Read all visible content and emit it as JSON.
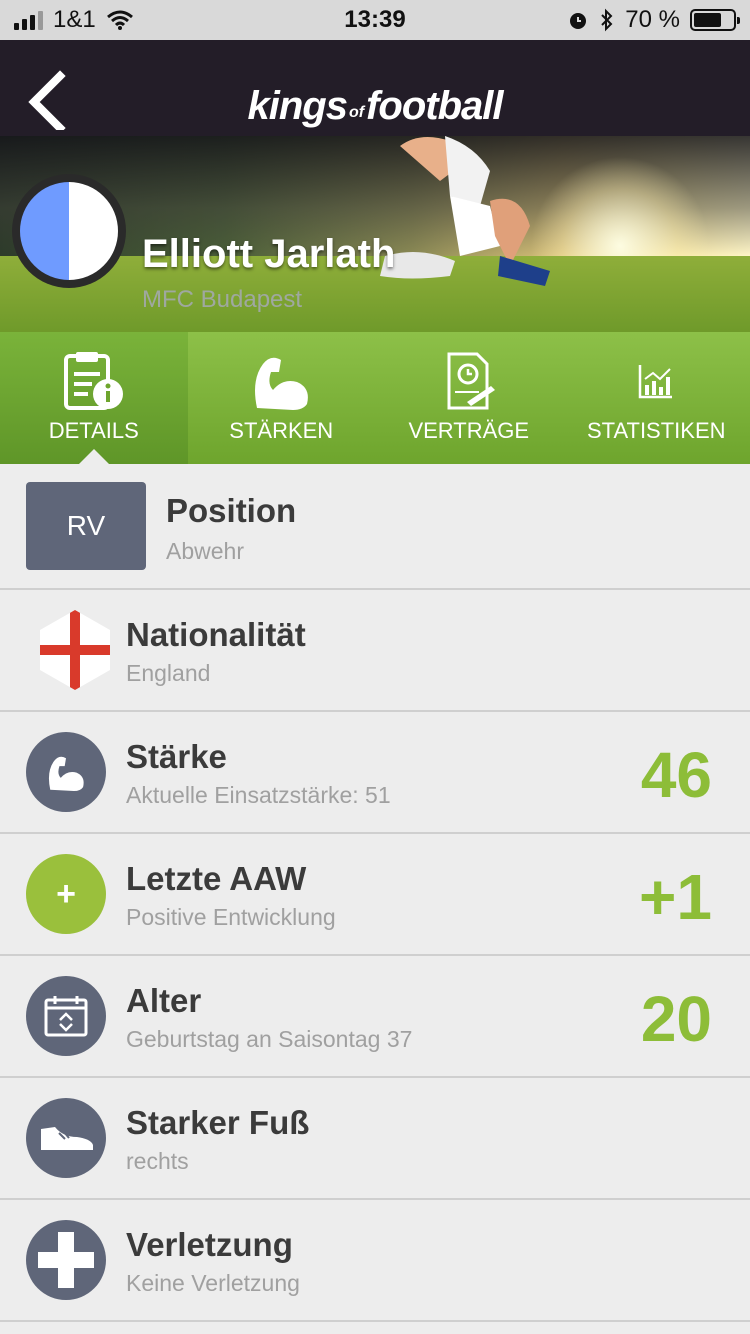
{
  "status_bar": {
    "carrier": "1&1",
    "time": "13:39",
    "battery": "70 %"
  },
  "header": {
    "brand_kings": "kings",
    "brand_of": "of",
    "brand_football": "football"
  },
  "player": {
    "name": "Elliott Jarlath",
    "club": "MFC Budapest"
  },
  "tabs": [
    {
      "label": "DETAILS",
      "icon": "clipboard-info-icon",
      "active": true
    },
    {
      "label": "STÄRKEN",
      "icon": "biceps-icon",
      "active": false
    },
    {
      "label": "VERTRÄGE",
      "icon": "contract-icon",
      "active": false
    },
    {
      "label": "STATISTIKEN",
      "icon": "chart-icon",
      "active": false
    }
  ],
  "details": [
    {
      "icon_text": "RV",
      "title": "Position",
      "subtitle": "Abwehr",
      "value": ""
    },
    {
      "icon": "england-flag-icon",
      "title": "Nationalität",
      "subtitle": "England",
      "value": ""
    },
    {
      "icon": "biceps-icon",
      "title": "Stärke",
      "subtitle": "Aktuelle Einsatzstärke: 51",
      "value": "46"
    },
    {
      "icon_text": "+",
      "title": "Letzte AAW",
      "subtitle": "Positive Entwicklung",
      "value": "+1"
    },
    {
      "icon": "calendar-icon",
      "title": "Alter",
      "subtitle": "Geburtstag an Saisontag 37",
      "value": "20"
    },
    {
      "icon": "football-boot-icon",
      "title": "Starker Fuß",
      "subtitle": "rechts",
      "value": ""
    },
    {
      "icon": "medical-cross-icon",
      "title": "Verletzung",
      "subtitle": "Keine Verletzung",
      "value": ""
    }
  ],
  "colors": {
    "accent_green": "#8dbd38",
    "nav_dark": "#231d28",
    "icon_slate": "#5f6679"
  }
}
